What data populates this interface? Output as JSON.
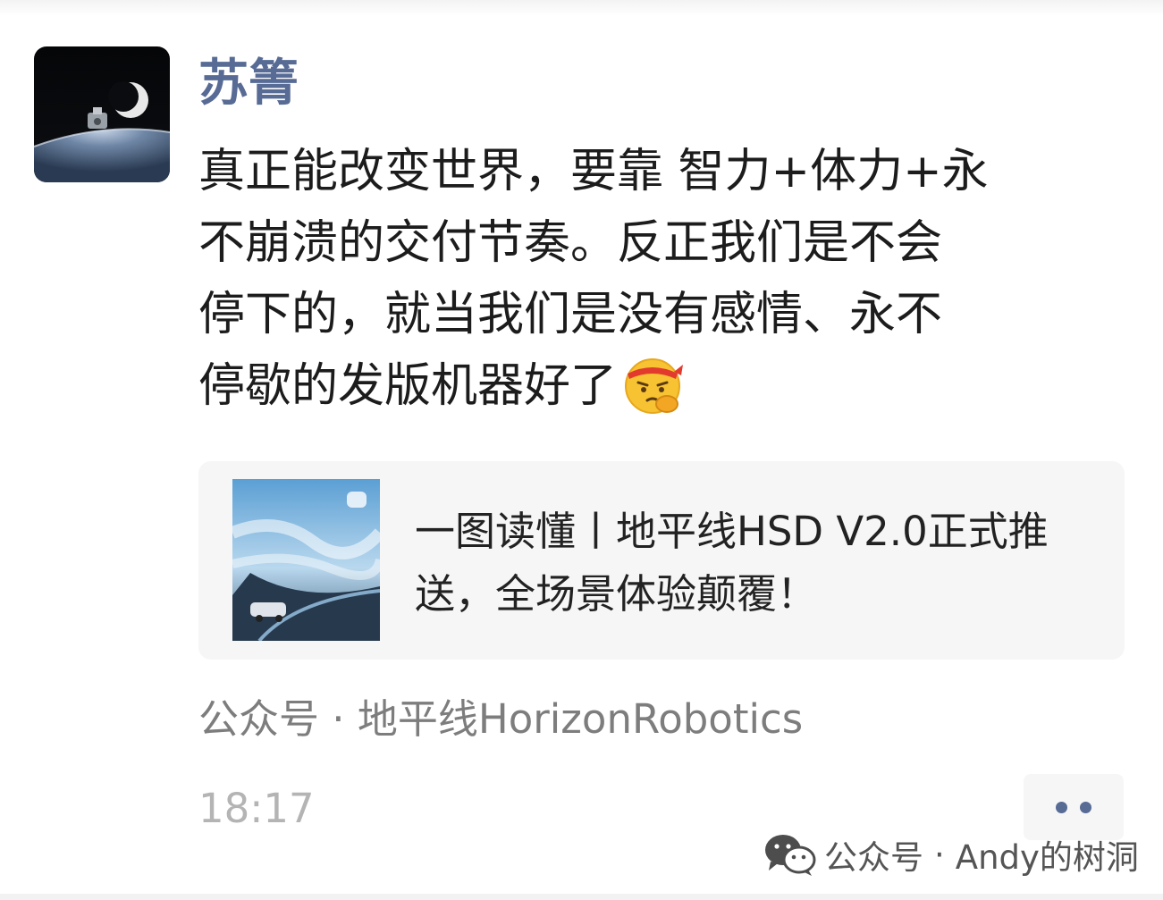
{
  "post": {
    "author_name": "苏箐",
    "text_lines": [
      "真正能改变世界，要靠 智力+体力+永",
      "不崩溃的交付节奏。反正我们是不会",
      "停下的，就当我们是没有感情、永不",
      "停歇的发版机器好了"
    ],
    "emoji_icon": "face-with-headband-hand-over-mouth-emoji",
    "link_card": {
      "title_lines": [
        "一图读懂丨地平线HSD V2.0正式推",
        "送，全场景体验颠覆！"
      ],
      "thumbnail_icon": "car-highway-sky-thumbnail"
    },
    "source": "公众号 · 地平线HorizonRobotics",
    "time": "18:17",
    "more_icon": "more-dots-icon"
  },
  "watermark": {
    "label": "公众号",
    "separator": "·",
    "account": "Andy的树洞",
    "icon": "wechat-icon"
  },
  "colors": {
    "nickname": "#576b95",
    "text": "#1c1c1c",
    "card_bg": "#f6f6f6",
    "source": "#7d7d7d",
    "time": "#b4b4b4"
  }
}
